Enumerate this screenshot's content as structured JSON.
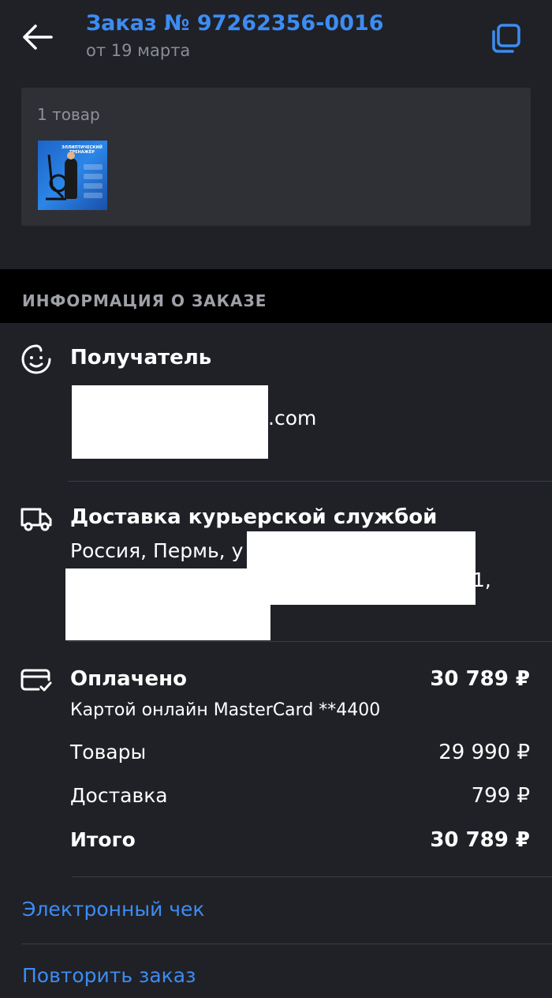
{
  "header": {
    "title": "Заказ № 97262356-0016",
    "subtitle": "от 19 марта",
    "back_icon": "arrow-left-icon",
    "copy_icon": "copy-icon",
    "accent_color": "#3d8cf2"
  },
  "items_card": {
    "count_label": "1 товар",
    "thumbnail_text": "ЭЛЛИПТИЧЕСКИЙ ТРЕНАЖЁР"
  },
  "section": {
    "title": "ИНФОРМАЦИЯ О ЗАКАЗЕ"
  },
  "recipient": {
    "icon": "smile-icon",
    "title": "Получатель",
    "email_tail": ".com"
  },
  "delivery": {
    "icon": "truck-icon",
    "title": "Доставка курьерской службой",
    "address_start": "Россия, Пермь, у",
    "address_tail": "1,"
  },
  "payment": {
    "icon": "card-check-icon",
    "title": "Оплачено",
    "total_paid": "30 789 ₽",
    "method": "Картой онлайн MasterCard **4400",
    "goods_label": "Товары",
    "goods_value": "29 990 ₽",
    "delivery_label": "Доставка",
    "delivery_value": "799 ₽",
    "total_label": "Итого",
    "total_value": "30 789 ₽"
  },
  "links": {
    "receipt": "Электронный чек",
    "repeat": "Повторить заказ"
  }
}
